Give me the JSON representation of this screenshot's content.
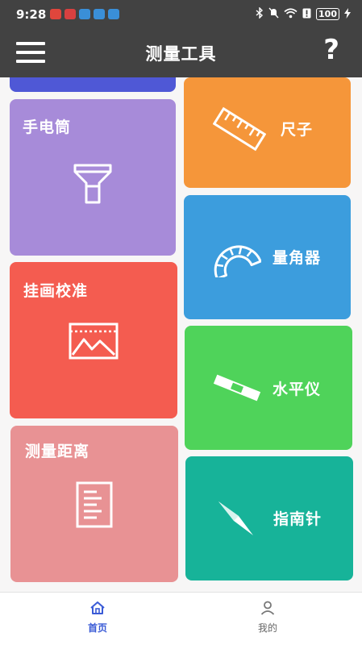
{
  "status_bar": {
    "time": "9:28",
    "notification_colors": [
      "#e0463c",
      "#d84040",
      "#3a8fd8",
      "#3a8fd8",
      "#3a8fd8"
    ],
    "bluetooth": "✱",
    "wifi": "📶",
    "battery": "100"
  },
  "app_bar": {
    "menu_icon": "hamburger-menu-icon",
    "title": "测量工具",
    "help_label": "?"
  },
  "tools": [
    {
      "id": "flashlight",
      "label": "手电筒",
      "color": "#a78bd9",
      "icon": "flashlight-icon"
    },
    {
      "id": "ruler",
      "label": "尺子",
      "color": "#f5963a",
      "icon": "ruler-icon"
    },
    {
      "id": "protractor",
      "label": "量角器",
      "color": "#3c9ddd",
      "icon": "protractor-icon"
    },
    {
      "id": "picture-level",
      "label": "挂画校准",
      "color": "#f45c50",
      "icon": "picture-frame-icon"
    },
    {
      "id": "spirit-level",
      "label": "水平仪",
      "color": "#4fd35a",
      "icon": "spirit-level-icon"
    },
    {
      "id": "distance",
      "label": "测量距离",
      "color": "#e89294",
      "icon": "document-lines-icon"
    },
    {
      "id": "compass",
      "label": "指南针",
      "color": "#17b399",
      "icon": "compass-needle-icon"
    }
  ],
  "partial_top_card_color": "#4f58d6",
  "bottom_nav": {
    "items": [
      {
        "label": "首页",
        "icon": "home-icon",
        "active": true,
        "color": "#3a5bd6"
      },
      {
        "label": "我的",
        "icon": "person-icon",
        "active": false,
        "color": "#666666"
      }
    ]
  }
}
